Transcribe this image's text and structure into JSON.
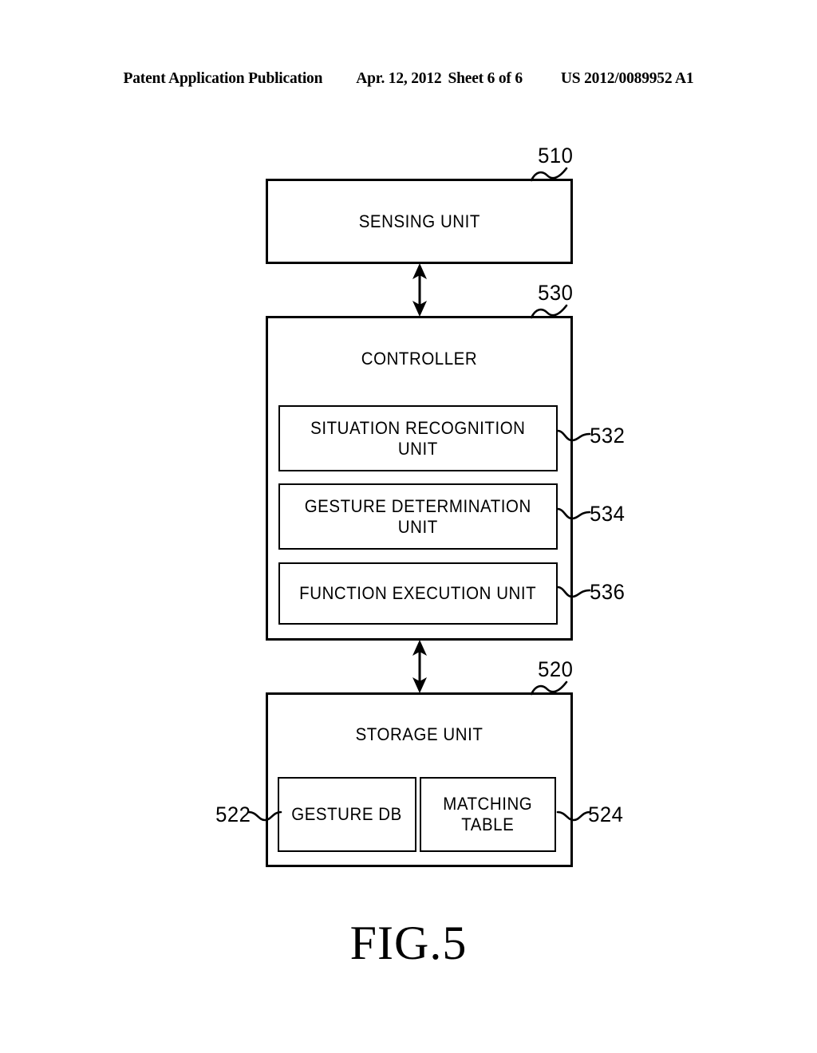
{
  "header": {
    "publication": "Patent Application Publication",
    "date": "Apr. 12, 2012",
    "sheet": "Sheet 6 of 6",
    "publication_number": "US 2012/0089952 A1"
  },
  "figure": {
    "caption": "FIG.5",
    "blocks": {
      "sensing_unit": {
        "label": "SENSING UNIT",
        "ref": "510"
      },
      "controller": {
        "label": "CONTROLLER",
        "ref": "530"
      },
      "situation_recognition_unit": {
        "label": "SITUATION RECOGNITION\nUNIT",
        "ref": "532"
      },
      "gesture_determination_unit": {
        "label": "GESTURE DETERMINATION\nUNIT",
        "ref": "534"
      },
      "function_execution_unit": {
        "label": "FUNCTION EXECUTION UNIT",
        "ref": "536"
      },
      "storage_unit": {
        "label": "STORAGE UNIT",
        "ref": "520"
      },
      "gesture_db": {
        "label": "GESTURE DB",
        "ref": "522"
      },
      "matching_table": {
        "label": "MATCHING\nTABLE",
        "ref": "524"
      }
    },
    "connectors": [
      {
        "name": "sensing-to-controller",
        "type": "double-headed-arrow",
        "orientation": "vertical"
      },
      {
        "name": "controller-to-storage",
        "type": "double-headed-arrow",
        "orientation": "vertical"
      }
    ]
  },
  "colors": {
    "ink": "#000000",
    "paper": "#ffffff"
  }
}
